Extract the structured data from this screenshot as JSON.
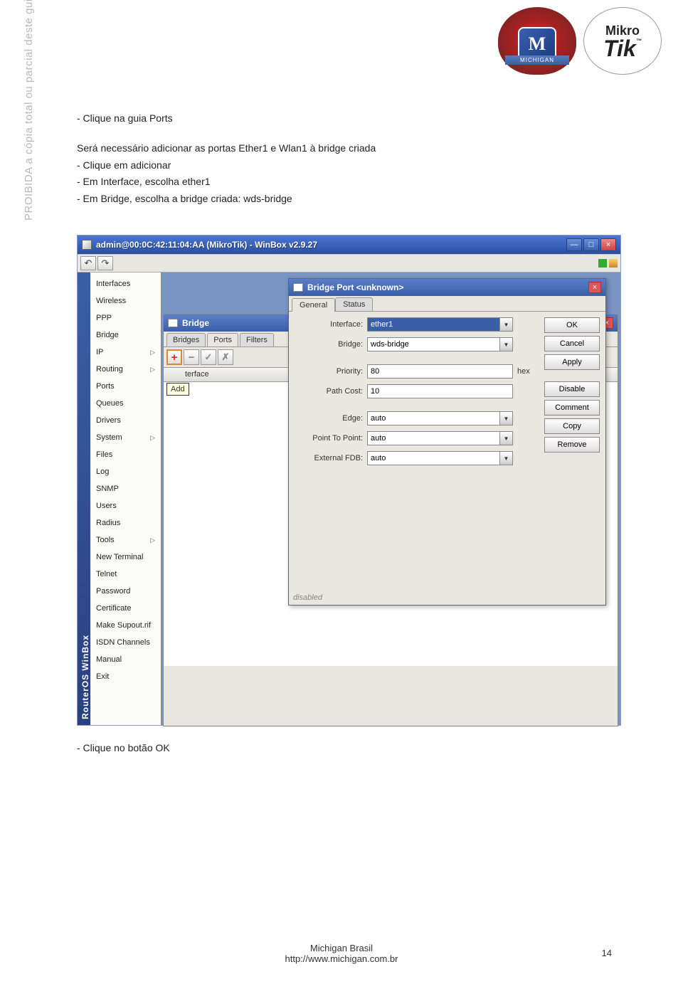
{
  "watermark": "PROIBIDA a cópia total ou parcial deste guia exclusivo de referência, sem autorização do autor.",
  "logos": {
    "michigan_banner": "MICHIGAN",
    "michigan_m": "M",
    "mikrotik_top": "Mikro",
    "mikrotik_bot": "Tik",
    "tm": "™"
  },
  "body": {
    "heading": "- Clique na guia Ports",
    "line1": "Será necessário adicionar as portas Ether1 e Wlan1 à bridge criada",
    "line2": "- Clique em adicionar",
    "line3": "- Em Interface, escolha ether1",
    "line4": "- Em Bridge, escolha a bridge criada: wds-bridge"
  },
  "winbox": {
    "title": "admin@00:0C:42:11:04:AA (MikroTik) - WinBox v2.9.27",
    "vertical_brand": "RouterOS WinBox",
    "menu": [
      {
        "label": "Interfaces"
      },
      {
        "label": "Wireless"
      },
      {
        "label": "PPP"
      },
      {
        "label": "Bridge"
      },
      {
        "label": "IP",
        "arrow": true
      },
      {
        "label": "Routing",
        "arrow": true
      },
      {
        "label": "Ports"
      },
      {
        "label": "Queues"
      },
      {
        "label": "Drivers"
      },
      {
        "label": "System",
        "arrow": true
      },
      {
        "label": "Files"
      },
      {
        "label": "Log"
      },
      {
        "label": "SNMP"
      },
      {
        "label": "Users"
      },
      {
        "label": "Radius"
      },
      {
        "label": "Tools",
        "arrow": true
      },
      {
        "label": "New Terminal"
      },
      {
        "label": "Telnet"
      },
      {
        "label": "Password"
      },
      {
        "label": "Certificate"
      },
      {
        "label": "Make Supout.rif"
      },
      {
        "label": "ISDN Channels"
      },
      {
        "label": "Manual"
      },
      {
        "label": "Exit"
      }
    ]
  },
  "bridge_window": {
    "title": "Bridge",
    "tabs": [
      "Bridges",
      "Ports",
      "Filters"
    ],
    "active_tab": "Ports",
    "add_tooltip": "Add",
    "col_header": "terface"
  },
  "port_dialog": {
    "title": "Bridge Port <unknown>",
    "tabs": [
      "General",
      "Status"
    ],
    "active_tab": "General",
    "fields": {
      "interface_label": "Interface:",
      "interface_value": "ether1",
      "bridge_label": "Bridge:",
      "bridge_value": "wds-bridge",
      "priority_label": "Priority:",
      "priority_value": "80",
      "priority_suffix": "hex",
      "pathcost_label": "Path Cost:",
      "pathcost_value": "10",
      "edge_label": "Edge:",
      "edge_value": "auto",
      "ptp_label": "Point To Point:",
      "ptp_value": "auto",
      "fdb_label": "External FDB:",
      "fdb_value": "auto"
    },
    "buttons": [
      "OK",
      "Cancel",
      "Apply",
      "Disable",
      "Comment",
      "Copy",
      "Remove"
    ],
    "status": "disabled"
  },
  "footer_text": "- Clique no botão OK",
  "page_footer": {
    "line1": "Michigan Brasil",
    "line2": "http://www.michigan.com.br",
    "page": "14"
  }
}
